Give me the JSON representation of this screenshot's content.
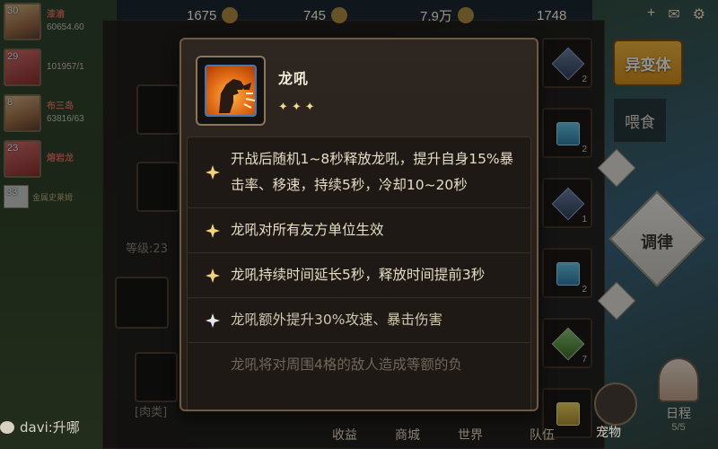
{
  "topbar": {
    "resources": [
      {
        "value": "1675",
        "icon": "gold-coin-icon"
      },
      {
        "value": "745",
        "icon": "leaf-icon"
      },
      {
        "value": "7.9万",
        "icon": "coin-icon"
      },
      {
        "value": "1748",
        "icon": "crystal-icon"
      }
    ],
    "icons": [
      "add-icon",
      "mail-icon",
      "settings-icon"
    ]
  },
  "players": [
    {
      "level": "30",
      "name": "漆渝",
      "score": "60654.60"
    },
    {
      "level": "29",
      "name": "",
      "score": "101957/1"
    },
    {
      "level": "8",
      "name": "布三岛",
      "score": "63816/63"
    },
    {
      "level": "23",
      "name": "熔岩龙",
      "score": ""
    }
  ],
  "slime": {
    "level": "33",
    "name": "金属史莱姆"
  },
  "underlying": {
    "level_text": "等级:23",
    "category_label": "[肉类]"
  },
  "gems": [
    {
      "count": "2",
      "kind": "blue"
    },
    {
      "count": "2",
      "kind": "teal"
    },
    {
      "count": "1",
      "kind": "blue"
    },
    {
      "count": "2",
      "kind": "teal"
    },
    {
      "count": "7",
      "kind": "green"
    },
    {
      "count": "",
      "kind": "gold"
    }
  ],
  "right_buttons": {
    "mutate": "异变体",
    "feed": "喂食",
    "tune": "调律",
    "schedule": "日程",
    "schedule_sub": "5/5",
    "pet": "宠物"
  },
  "bottombar": {
    "chat_text": "davi:升哪",
    "nav": [
      "收益",
      "商城",
      "世界",
      "队伍"
    ]
  },
  "tooltip": {
    "skill_name": "龙吼",
    "stars": "✦✦✦",
    "effects": [
      {
        "text": "开战后随机1~8秒释放龙吼，提升自身15%暴击率、移速，持续5秒，冷却10~20秒",
        "active": true
      },
      {
        "text": "龙吼对所有友方单位生效",
        "active": true
      },
      {
        "text": "龙吼持续时间延长5秒，释放时间提前3秒",
        "active": true
      },
      {
        "text": "龙吼额外提升30%攻速、暴击伤害",
        "active": false
      },
      {
        "text": "龙吼将对周围4格的敌人造成等额的负",
        "active": false
      }
    ]
  },
  "colors": {
    "accent_gold": "#f2dc8a",
    "mutate_orange": "#f0a424",
    "active_spark": "#f2d27a",
    "inactive_spark": "#e8e8f0"
  }
}
